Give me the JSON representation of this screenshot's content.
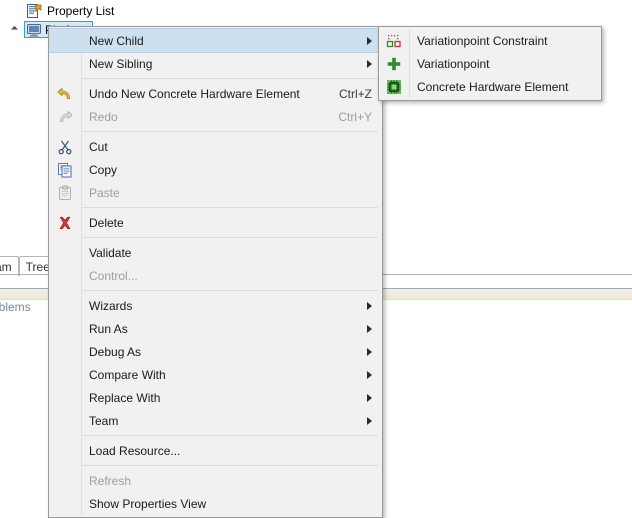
{
  "background": {
    "property_list_label": "Property List",
    "property_list_icon": "property-list-icon",
    "tree_node_label": "Platform",
    "tree_node_icon": "monitor-icon",
    "editor_tabs": [
      {
        "label": "ram",
        "icon": "diagram-tab-icon"
      },
      {
        "label": "Tree",
        "icon": "tree-tab-icon"
      }
    ],
    "problems_tab_label": "roblems"
  },
  "context_menu": {
    "items": [
      {
        "label": "New Child",
        "icon": "",
        "accel": "",
        "submenu": true,
        "disabled": false,
        "highlight": true,
        "sep_after": false
      },
      {
        "label": "New Sibling",
        "icon": "",
        "accel": "",
        "submenu": true,
        "disabled": false,
        "highlight": false,
        "sep_after": true
      },
      {
        "label": "Undo New Concrete Hardware Element",
        "icon": "undo-icon",
        "accel": "Ctrl+Z",
        "submenu": false,
        "disabled": false,
        "highlight": false,
        "sep_after": false
      },
      {
        "label": "Redo",
        "icon": "redo-icon",
        "accel": "Ctrl+Y",
        "submenu": false,
        "disabled": true,
        "highlight": false,
        "sep_after": true
      },
      {
        "label": "Cut",
        "icon": "cut-icon",
        "accel": "",
        "submenu": false,
        "disabled": false,
        "highlight": false,
        "sep_after": false
      },
      {
        "label": "Copy",
        "icon": "copy-icon",
        "accel": "",
        "submenu": false,
        "disabled": false,
        "highlight": false,
        "sep_after": false
      },
      {
        "label": "Paste",
        "icon": "paste-icon",
        "accel": "",
        "submenu": false,
        "disabled": true,
        "highlight": false,
        "sep_after": true
      },
      {
        "label": "Delete",
        "icon": "delete-icon",
        "accel": "",
        "submenu": false,
        "disabled": false,
        "highlight": false,
        "sep_after": true
      },
      {
        "label": "Validate",
        "icon": "",
        "accel": "",
        "submenu": false,
        "disabled": false,
        "highlight": false,
        "sep_after": false
      },
      {
        "label": "Control...",
        "icon": "",
        "accel": "",
        "submenu": false,
        "disabled": true,
        "highlight": false,
        "sep_after": true
      },
      {
        "label": "Wizards",
        "icon": "",
        "accel": "",
        "submenu": true,
        "disabled": false,
        "highlight": false,
        "sep_after": false
      },
      {
        "label": "Run As",
        "icon": "",
        "accel": "",
        "submenu": true,
        "disabled": false,
        "highlight": false,
        "sep_after": false
      },
      {
        "label": "Debug As",
        "icon": "",
        "accel": "",
        "submenu": true,
        "disabled": false,
        "highlight": false,
        "sep_after": false
      },
      {
        "label": "Compare With",
        "icon": "",
        "accel": "",
        "submenu": true,
        "disabled": false,
        "highlight": false,
        "sep_after": false
      },
      {
        "label": "Replace With",
        "icon": "",
        "accel": "",
        "submenu": true,
        "disabled": false,
        "highlight": false,
        "sep_after": false
      },
      {
        "label": "Team",
        "icon": "",
        "accel": "",
        "submenu": true,
        "disabled": false,
        "highlight": false,
        "sep_after": true
      },
      {
        "label": "Load Resource...",
        "icon": "",
        "accel": "",
        "submenu": false,
        "disabled": false,
        "highlight": false,
        "sep_after": true
      },
      {
        "label": "Refresh",
        "icon": "",
        "accel": "",
        "submenu": false,
        "disabled": true,
        "highlight": false,
        "sep_after": false
      },
      {
        "label": "Show Properties View",
        "icon": "",
        "accel": "",
        "submenu": false,
        "disabled": false,
        "highlight": false,
        "sep_after": false
      }
    ]
  },
  "submenu": {
    "parent": "New Child",
    "items": [
      {
        "label": "Variationpoint Constraint",
        "icon": "variationpoint-constraint-icon"
      },
      {
        "label": "Variationpoint",
        "icon": "plus-icon"
      },
      {
        "label": "Concrete Hardware Element",
        "icon": "hardware-chip-icon"
      }
    ]
  },
  "colors": {
    "menu_bg": "#f1f1f1",
    "menu_border": "#9a9a9a",
    "highlight_bg": "#cde0f0",
    "highlight_border": "#b6cfe5",
    "disabled_text": "#9d9d9d",
    "selection_border": "#3c9bdd",
    "selection_fill": "#d4eaf8",
    "delete_red": "#cc3333",
    "undo_yellow": "#e8b23a",
    "chip_green": "#2e8b2e"
  }
}
